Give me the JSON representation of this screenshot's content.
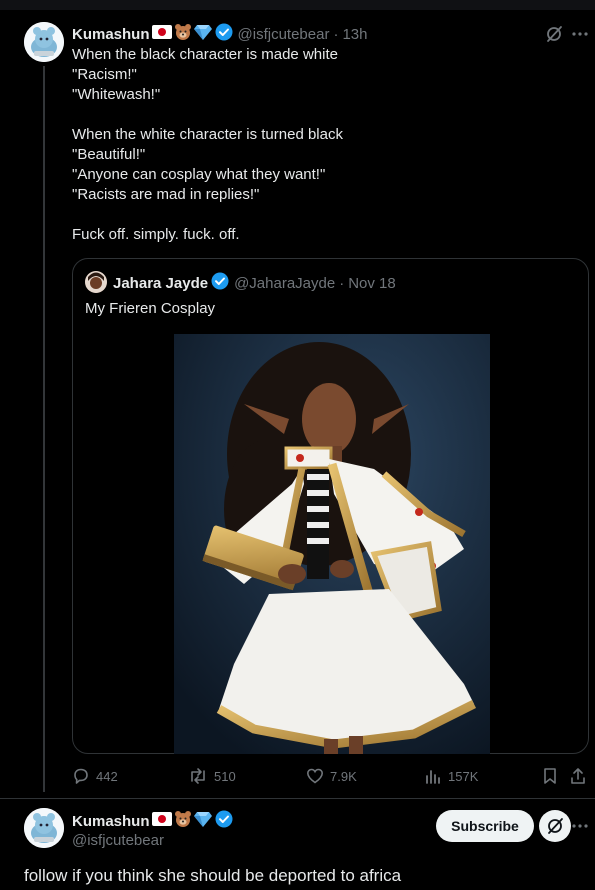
{
  "main_post": {
    "author_name": "Kumashun",
    "handle": "@isfjcutebear",
    "separator": "·",
    "time": "13h",
    "emojis": [
      "japan-flag-icon",
      "bear-face-icon",
      "gem-icon"
    ],
    "text": "When the black character is made white\n \"Racism!\"\n \"Whitewash!\"\n\n When the white character is turned black\n \"Beautiful!\"\n \"Anyone can cosplay what they want!\"\n \"Racists are mad in replies!\"\n\nFuck off. simply. fuck. off."
  },
  "quoted_post": {
    "author_name": "Jahara Jayde",
    "handle": "@JaharaJayde",
    "separator": "·",
    "date": "Nov 18",
    "text": "My Frieren Cosplay"
  },
  "actions": {
    "replies": "442",
    "reposts": "510",
    "likes": "7.9K",
    "views": "157K"
  },
  "reply_post": {
    "author_name": "Kumashun",
    "handle": "@isfjcutebear",
    "subscribe_label": "Subscribe",
    "text": "follow if you think she should be deported to africa"
  },
  "colors": {
    "background": "#000000",
    "text_primary": "#e7e9ea",
    "text_secondary": "#71767b",
    "verified_blue": "#1d9bf0",
    "border": "#2f3336"
  }
}
